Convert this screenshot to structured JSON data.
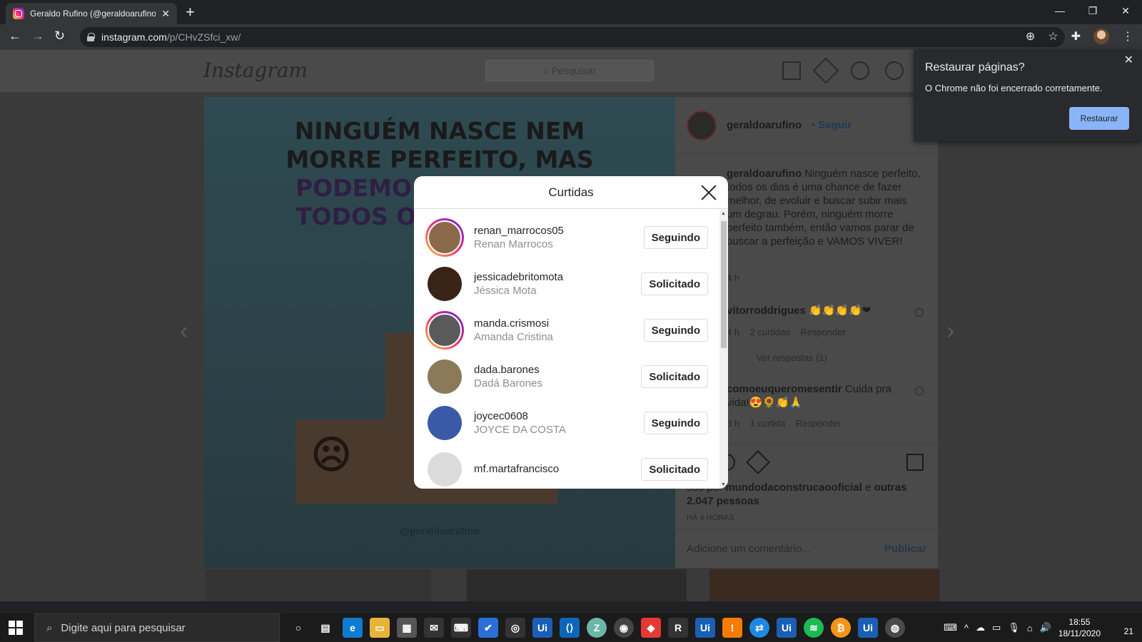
{
  "browser": {
    "tab_title": "Geraldo Rufino (@geraldoarufino",
    "new_tab": "+",
    "url_domain": "instagram.com",
    "url_path": "/p/CHvZSfci_xw/",
    "window_controls": [
      "—",
      "❐",
      "✕"
    ]
  },
  "instagram": {
    "logo": "Instagram",
    "search_placeholder": "Pesquisar",
    "post_image": {
      "line1": "NINGUÉM NASCE NEM",
      "line2": "MORRE PERFEITO, MAS",
      "line3": "PODEMOS",
      "line4": "TODOS O",
      "handle": "@geraldoarufino"
    },
    "author": {
      "username": "geraldoarufino",
      "follow": "• Seguir"
    },
    "caption": {
      "username": "geraldoarufino",
      "text": "Ninguém nasce perfeito, todos os dias é uma chance de fazer melhor, de evoluir e buscar subir mais um degrau. Porém, ninguém morre perfeito também, então vamos parar de buscar a perfeição e VAMOS VIVER!",
      "time": "4 h"
    },
    "comments": [
      {
        "username": "vitorroddrigues",
        "text": "👏👏👏👏❤",
        "time": "4 h",
        "likes": "2 curtidas",
        "reply": "Responder",
        "view_replies": "Ver respostas (1)"
      },
      {
        "username": "comoeuqueromesentir",
        "text": "Cuida pra vida!😍🌻👏🙏",
        "time": "3 h",
        "likes": "1 curtida",
        "reply": "Responder"
      }
    ],
    "liked_by_prefix": "tido por",
    "liked_by_user": "mundodaconstrucaooficial",
    "liked_by_connector": "e",
    "liked_by_others": "outras 2.047 pessoas",
    "posted_ago": "HÁ 4 HORAS",
    "add_comment_placeholder": "Adicione um comentário...",
    "publish": "Publicar"
  },
  "likes_modal": {
    "title": "Curtidas",
    "users": [
      {
        "username": "renan_marrocos05",
        "fullname": "Renan Marrocos",
        "button": "Seguindo",
        "avatar_color": "#8a6a4a",
        "ring": true
      },
      {
        "username": "jessicadebritomota",
        "fullname": "Jéssica Mota",
        "button": "Solicitado",
        "avatar_color": "#3a2418",
        "ring": false
      },
      {
        "username": "manda.crismosi",
        "fullname": "Amanda Cristina",
        "button": "Seguindo",
        "avatar_color": "#5a5a5a",
        "ring": true
      },
      {
        "username": "dada.barones",
        "fullname": "Dadá Barones",
        "button": "Solicitado",
        "avatar_color": "#8a7a5a",
        "ring": false
      },
      {
        "username": "joycec0608",
        "fullname": "JOYCE DA COSTA",
        "button": "Seguindo",
        "avatar_color": "#3a5aa8",
        "ring": false
      },
      {
        "username": "mf.martafrancisco",
        "fullname": "",
        "button": "Solicitado",
        "avatar_color": "#dbdbdb",
        "ring": false
      }
    ]
  },
  "restore_popup": {
    "title": "Restaurar páginas?",
    "message": "O Chrome não foi encerrado corretamente.",
    "button": "Restaurar"
  },
  "taskbar": {
    "search_placeholder": "Digite aqui para pesquisar",
    "time": "18:55",
    "date": "18/11/2020",
    "notifications": "21"
  }
}
